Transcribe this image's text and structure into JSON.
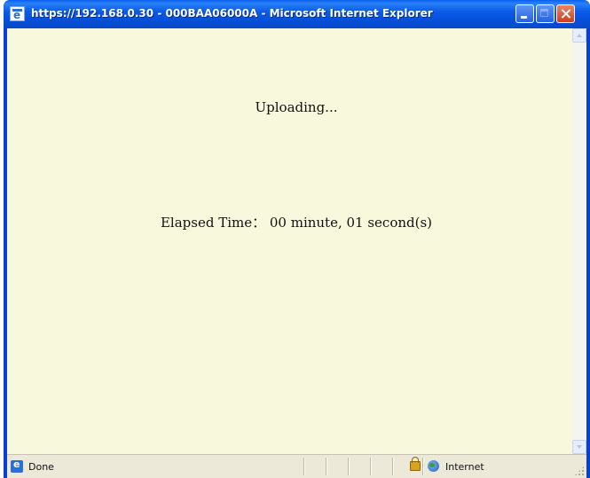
{
  "window": {
    "title": "https://192.168.0.30 - 000BAA06000A - Microsoft Internet Explorer"
  },
  "content": {
    "uploading_text": "Uploading...",
    "elapsed_text": "Elapsed Time： 00 minute, 01 second(s)"
  },
  "statusbar": {
    "status_text": "Done",
    "zone_text": "Internet"
  },
  "icons": {
    "title": "ie-page-icon",
    "status": "ie-page-icon",
    "security": "lock-icon",
    "zone": "globe-icon"
  }
}
